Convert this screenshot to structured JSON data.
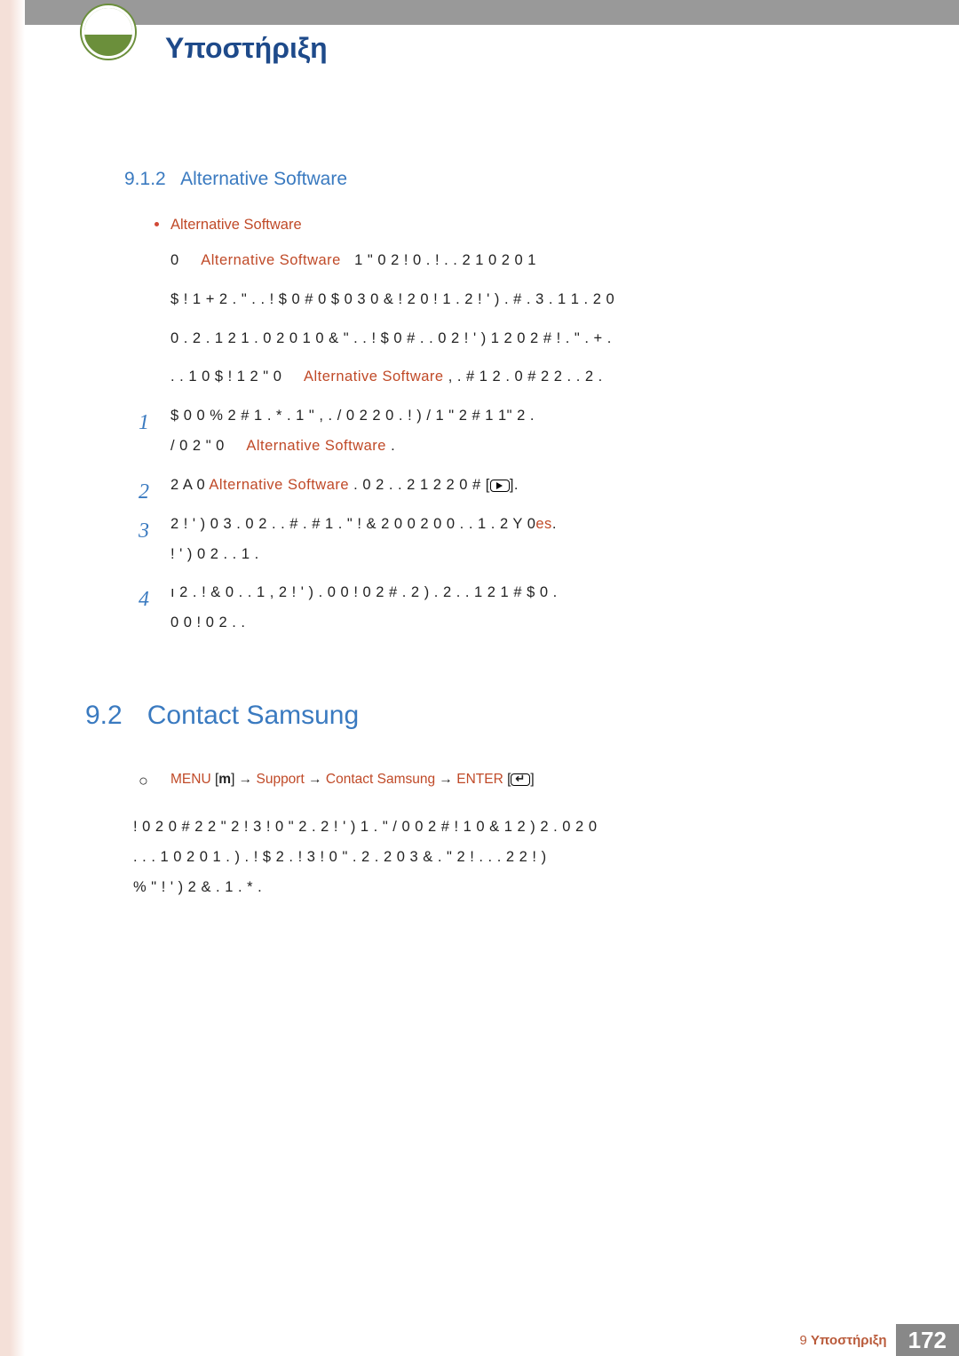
{
  "header_title": "Υποστήριξη",
  "sec912": {
    "number": "9.1.2",
    "title": "Alternative Software",
    "bullet": "Alternative Software",
    "p1a": "0",
    "p1b": "Alternative Software",
    "p1c": "1 \" 0   2 !   0 .  ! .    . 2        1 0 2 0         1",
    "p2": "$ ! 1         + 2 . \" . . ! $ 0    # 0  $ 0 3  0 & ! 2 0 ! 1 . 2  ! ' )  .         # .   3 . 1 1 . 2 0",
    "p3": "0   . 2 . 1 2  1 . 0 2 0 1 0 & \"       . . ! $ 0    # .     . 0 2  ! ' )  1 2  0  2  # ! .        \" . + .",
    "p4a": ". .       1  0 $ ! 1 2   \" 0",
    "p4b": "Alternative Software",
    "p4c": " , .      #    1 2 . 0 # 2 2 .      . 2 .",
    "step1a": "$ 0   0  % 2  #    1  . * .      1  \" , . / 0  2 2 0 . !      )  / 1 \" 2  #    1      1\" 2 .",
    "step1b": "/ 0   2   \" 0",
    "step1c": "Alternative Software",
    "step1d": ".",
    "step2a": "2 A 0",
    "step2b": "Alternative Software",
    "step2c": ".   0  2 . . 2  1 2 2 0      #    [",
    "step2d": "].",
    "step3a": "2  ! ' )  0  3 .     0 2 . .       # .     # 1 . \" ! & 2 0       0 2 0      0 . .      1 .            2 Y 0",
    "step3b": "es",
    "step3c": ".",
    "step3line2": "  ! ' )   0     2   . .       1 .",
    "step4": "ı 2 .     ! & 0 .  .     1 , 2  ! ' )  .  0  0 !      0  2 # . 2 )  . 2 . .  1 2 1 #   $ 0 .",
    "step4line2": "0  0 !        0 2 . ."
  },
  "sec92": {
    "number": "9.2",
    "title": "Contact Samsung",
    "path_menu": "MENU",
    "path_support": "Support",
    "path_contact": "Contact Samsung",
    "path_enter": "ENTER",
    "body1": "!      0 2 0 # 2 2  \" 2      !  3  ! 0 \" 2 . 2    ! ' )  1 . \" / 0    0  2  # ! 1 0 & 1 2  ) 2 .      0 2 0",
    "body2": ". . .      1 0 2 0      1  . ) . ! $    2 .     !  3  ! 0 \" . 2 . 2    0 3 &   . \"     2 ! . .       . 2  2 ! )",
    "body3": "%  \" ! ' )  2 & .     1  . * ."
  },
  "footer": {
    "chapter_num": "9",
    "chapter_title": "Υποστήριξη",
    "page": "172"
  }
}
